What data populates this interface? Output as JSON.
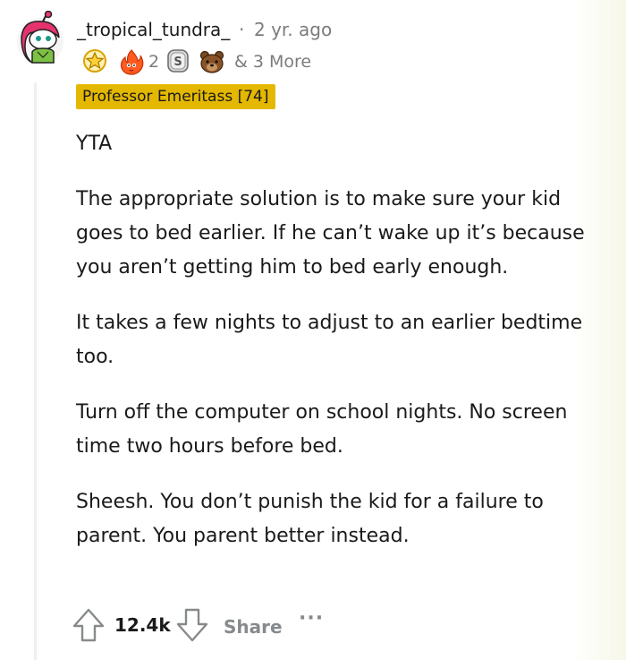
{
  "comment": {
    "author": "_tropical_tundra_",
    "separator": "·",
    "timestamp": "2 yr. ago",
    "awards": {
      "icons": [
        "star-badge-icon",
        "fire-flame-icon",
        "silver-coin-icon",
        "bear-icon"
      ],
      "count": "2",
      "more_label": "& 3 More"
    },
    "flair": "Professor Emeritass [74]",
    "paragraphs": [
      "YTA",
      "The appropriate solution is to make sure your kid goes to bed earlier. If he can’t wake up it’s because you aren’t getting him to bed early enough.",
      "It takes a few nights to adjust to an earlier bedtime too.",
      "Turn off the computer on school nights. No screen time two hours before bed.",
      "Sheesh. You don’t punish the kid for a failure to parent. You parent better instead."
    ],
    "actions": {
      "score": "12.4k",
      "share_label": "Share",
      "more_label": "···"
    }
  },
  "colors": {
    "flair_background": "#e4b800",
    "muted_text": "#7c7c7c",
    "thread_line": "#edeff1"
  }
}
